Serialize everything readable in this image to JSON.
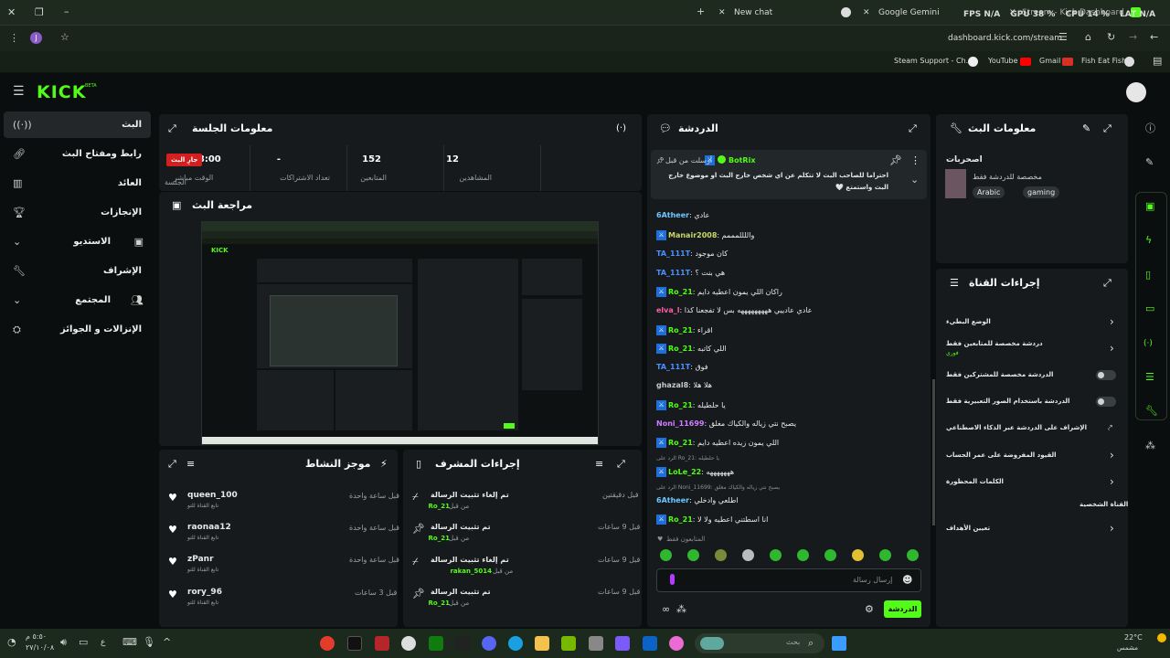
{
  "browser": {
    "tabs": [
      {
        "label": "Stream - Kick Dashboard"
      },
      {
        "label": "New chat"
      },
      {
        "label": "Google Gemini"
      }
    ],
    "overlay": {
      "fps_label": "FPS",
      "fps": "N/A",
      "gpu_label": "GPU",
      "gpu": "38 %",
      "cpu_label": "CPU",
      "cpu": "14 %",
      "lat_label": "LAT",
      "lat": "N/A"
    },
    "url": "dashboard.kick.com/stream",
    "bookmarks": [
      {
        "label": "Steam Support - Ch..."
      },
      {
        "label": "YouTube"
      },
      {
        "label": "Gmail"
      },
      {
        "label": "Fish Eat Fish"
      }
    ],
    "profile_initial": "J"
  },
  "kick": {
    "logo": "KICK",
    "logo_beta": "BETA"
  },
  "sidebar": {
    "items": [
      {
        "label": "البث"
      },
      {
        "label": "رابط ومفتاح البث"
      },
      {
        "label": "العائد"
      },
      {
        "label": "الإنجازات"
      },
      {
        "label": "الاستديو"
      },
      {
        "label": "الإشراف"
      },
      {
        "label": "المجتمع"
      },
      {
        "label": "الإنزالات و الجوائز"
      }
    ]
  },
  "session": {
    "title": "معلومات الجلسة",
    "live_badge": "جارِ البث",
    "live_label": "الجلسة",
    "stats": [
      {
        "value": "12",
        "label": "المشاهدين"
      },
      {
        "value": "152",
        "label": "المتابعين"
      },
      {
        "value": "-",
        "label": "تعداد الاشتراكات"
      },
      {
        "value": "00:08:00",
        "label": "الوقت مباشر"
      }
    ]
  },
  "preview": {
    "title": "مراجعة البث"
  },
  "activity": {
    "title": "موجز النشاط",
    "items": [
      {
        "user": "queen_100",
        "action": "تابع القناة للتو",
        "time": "قبل ساعة واحدة"
      },
      {
        "user": "raonaa12",
        "action": "تابع القناة للتو",
        "time": "قبل ساعة واحدة"
      },
      {
        "user": "zPanr",
        "action": "تابع القناة للتو",
        "time": "قبل ساعة واحدة"
      },
      {
        "user": "rory_96",
        "action": "تابع القناة للتو",
        "time": "قبل 3 ساعات"
      }
    ]
  },
  "mod_actions": {
    "title": "إجراءات المشرف",
    "items": [
      {
        "action": "تم إلغاء تثبيت الرسالة",
        "by_prefix": "من قبل",
        "by": "Ro_21",
        "time": "قبل دقيقتين"
      },
      {
        "action": "تم تثبيت الرسالة",
        "by_prefix": "من قبل",
        "by": "Ro_21",
        "time": "قبل 9 ساعات"
      },
      {
        "action": "تم إلغاء تثبيت الرسالة",
        "by_prefix": "من قبل",
        "by": "rakan_5014",
        "time": "قبل 9 ساعات"
      },
      {
        "action": "تم تثبيت الرسالة",
        "by_prefix": "من قبل",
        "by": "Ro_21",
        "time": "قبل 9 ساعات"
      }
    ]
  },
  "chat": {
    "title": "الدردشة",
    "pinned": {
      "meta": "أرسلت من قبل",
      "user": "BotRix",
      "text": "احتراما للصاحب البث لا تتكلم عن اي شخص خارج البث او موضوع خارج البث واستمتع 🤍"
    },
    "messages": [
      {
        "user": "6Atheer",
        "color": "#6ec6ff",
        "text": "عادي",
        "badge": false
      },
      {
        "user": "Manair2008",
        "color": "#c8d86a",
        "text": "واللللمممم",
        "badge": true
      },
      {
        "user": "TA_111T",
        "color": "#4a90ff",
        "text": "كان موجود",
        "badge": false
      },
      {
        "user": "TA_111T",
        "color": "#4a90ff",
        "text": "هي بنت ؟",
        "badge": false
      },
      {
        "user": "Ro_21",
        "color": "#53fc18",
        "text": "راكان اللي يمون اعطيه دايم",
        "badge": true
      },
      {
        "user": "elva_l",
        "color": "#ff5ea8",
        "text": "عادي عادييي هههههههههه بس لا تفجعنا كذا",
        "badge": false
      },
      {
        "user": "Ro_21",
        "color": "#53fc18",
        "text": "اقراء",
        "badge": true
      },
      {
        "user": "Ro_21",
        "color": "#53fc18",
        "text": "اللي كاتبه",
        "badge": true
      },
      {
        "user": "TA_111T",
        "color": "#4a90ff",
        "text": "فوق",
        "badge": false
      },
      {
        "user": "ghazal8",
        "color": "#c9c9c9",
        "text": "هلا هلا",
        "badge": false
      },
      {
        "user": "Ro_21",
        "color": "#53fc18",
        "text": "يا حلطيله",
        "badge": true
      },
      {
        "user": "Noni_11699",
        "color": "#d27cff",
        "text": "يصبح نتي زياله والكياك مغلق",
        "badge": false
      },
      {
        "user": "Ro_21",
        "color": "#53fc18",
        "text": "اللي يمون زيده اعطيه دايم",
        "badge": true
      },
      {
        "user": "LoLe_22",
        "color": "#53fc18",
        "text": "هههههههه",
        "badge": true,
        "reply": "الرد على Ro_21: يا حلطيله"
      },
      {
        "user": "6Atheer",
        "color": "#6ec6ff",
        "text": "اطلعي وادخلي",
        "badge": false,
        "reply": "الرد على Noni_11699: يصبح نتي زياله والكياك مغلق"
      },
      {
        "user": "Ro_21",
        "color": "#53fc18",
        "text": "انا اسطتني اعطيه ولا لا",
        "badge": true
      }
    ],
    "followers_only": "المتابعون فقط",
    "input_placeholder": "إرسال رسالة",
    "send_label": "الدردشة"
  },
  "stream_info": {
    "title": "معلومات البث",
    "category": "اصحربات",
    "desc": "مخصصة للدردشة فقط",
    "tags": [
      "Arabic",
      "gaming"
    ]
  },
  "channel_actions": {
    "title": "إجراءات القناة",
    "items": [
      {
        "label": "الوضع البطيء",
        "sub": "",
        "control": "chevron"
      },
      {
        "label": "دردشة مخصصة للمتابعين فقط",
        "sub": "فوري",
        "control": "chevron"
      },
      {
        "label": "الدردشة مخصصة للمشتركين فقط",
        "sub": "",
        "control": "toggle"
      },
      {
        "label": "الدردشة باستخدام الصور التعبيرية فقط",
        "sub": "",
        "control": "toggle"
      },
      {
        "label": "الإشراف على الدردشة عبر الذكاء الاصطناعي",
        "sub": "",
        "control": "link"
      },
      {
        "label": "القيود المفروضة على عمر الحساب",
        "sub": "",
        "control": "chevron"
      },
      {
        "label": "الكلمات المحظورة",
        "sub": "",
        "control": "chevron"
      }
    ],
    "personal_header": "القناة الشخصية",
    "goals": "تعيين الأهداف"
  },
  "taskbar": {
    "search_placeholder": "بحث",
    "weather_temp": "22°C",
    "weather_desc": "مشمس",
    "time": "٥:٥٠ م",
    "date": "٢٧/١٠/٠٨"
  },
  "colors": {
    "accent": "#53fc18",
    "live": "#d31f1f",
    "panel": "#161a1c"
  }
}
